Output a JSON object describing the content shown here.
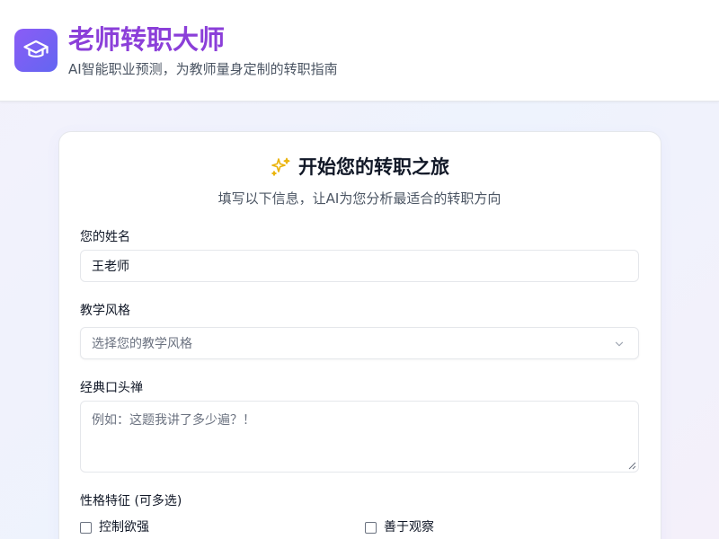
{
  "header": {
    "title": "老师转职大师",
    "subtitle": "AI智能职业预测，为教师量身定制的转职指南",
    "logo_icon": "graduation-cap-icon",
    "brand_color": "#8b3fd9"
  },
  "card": {
    "title_icon": "sparkles-icon",
    "title": "开始您的转职之旅",
    "subtitle": "填写以下信息，让AI为您分析最适合的转职方向"
  },
  "form": {
    "name": {
      "label": "您的姓名",
      "value": "王老师"
    },
    "teaching_style": {
      "label": "教学风格",
      "placeholder": "选择您的教学风格"
    },
    "catchphrase": {
      "label": "经典口头禅",
      "placeholder": "例如：这题我讲了多少遍？！"
    },
    "traits": {
      "label": "性格特征 (可多选)",
      "options": [
        {
          "label": "控制欲强",
          "checked": false
        },
        {
          "label": "善于观察",
          "checked": false
        }
      ]
    }
  }
}
